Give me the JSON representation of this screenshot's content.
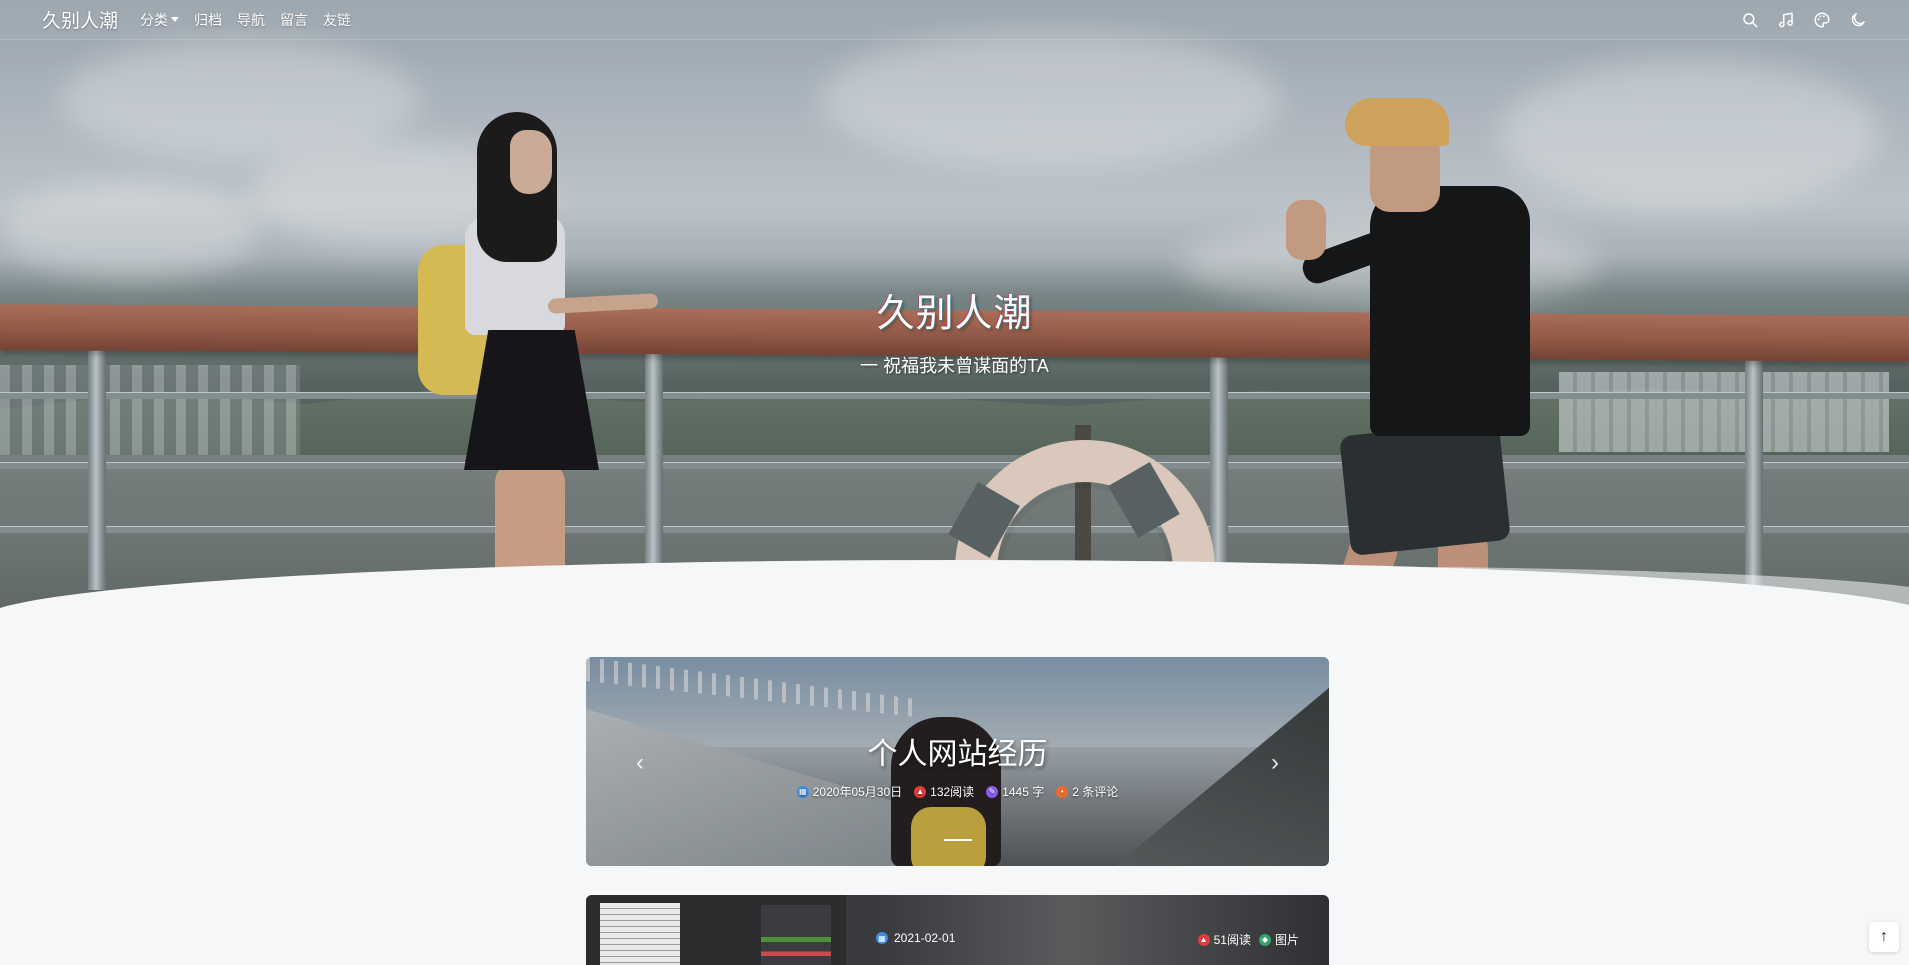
{
  "navbar": {
    "brand": "久别人潮",
    "items": [
      {
        "label": "分类",
        "has_dropdown": true
      },
      {
        "label": "归档"
      },
      {
        "label": "导航"
      },
      {
        "label": "留言"
      },
      {
        "label": "友链"
      }
    ],
    "right_icons": [
      "search-icon",
      "music-icon",
      "palette-icon",
      "moon-icon"
    ]
  },
  "hero": {
    "title": "久别人潮",
    "subtitle": "一 祝福我未曾谋面的TA"
  },
  "carousel": {
    "title": "个人网站经历",
    "meta": {
      "date": "2020年05月30日",
      "views": "132阅读",
      "words": "1445 字",
      "comments": "2 条评论"
    },
    "prev_icon": "chevron-left-icon",
    "next_icon": "chevron-right-icon"
  },
  "post_card": {
    "date": "2021-02-01",
    "views": "51阅读",
    "tag": "图片"
  },
  "colors": {
    "date_icon": "#3b8ee8",
    "views_icon": "#e23c3c",
    "words_icon": "#8a5cf0",
    "comments_icon": "#ee6b2c",
    "tag_icon": "#2fa66a"
  },
  "back_to_top": {
    "icon": "arrow-up-icon"
  }
}
